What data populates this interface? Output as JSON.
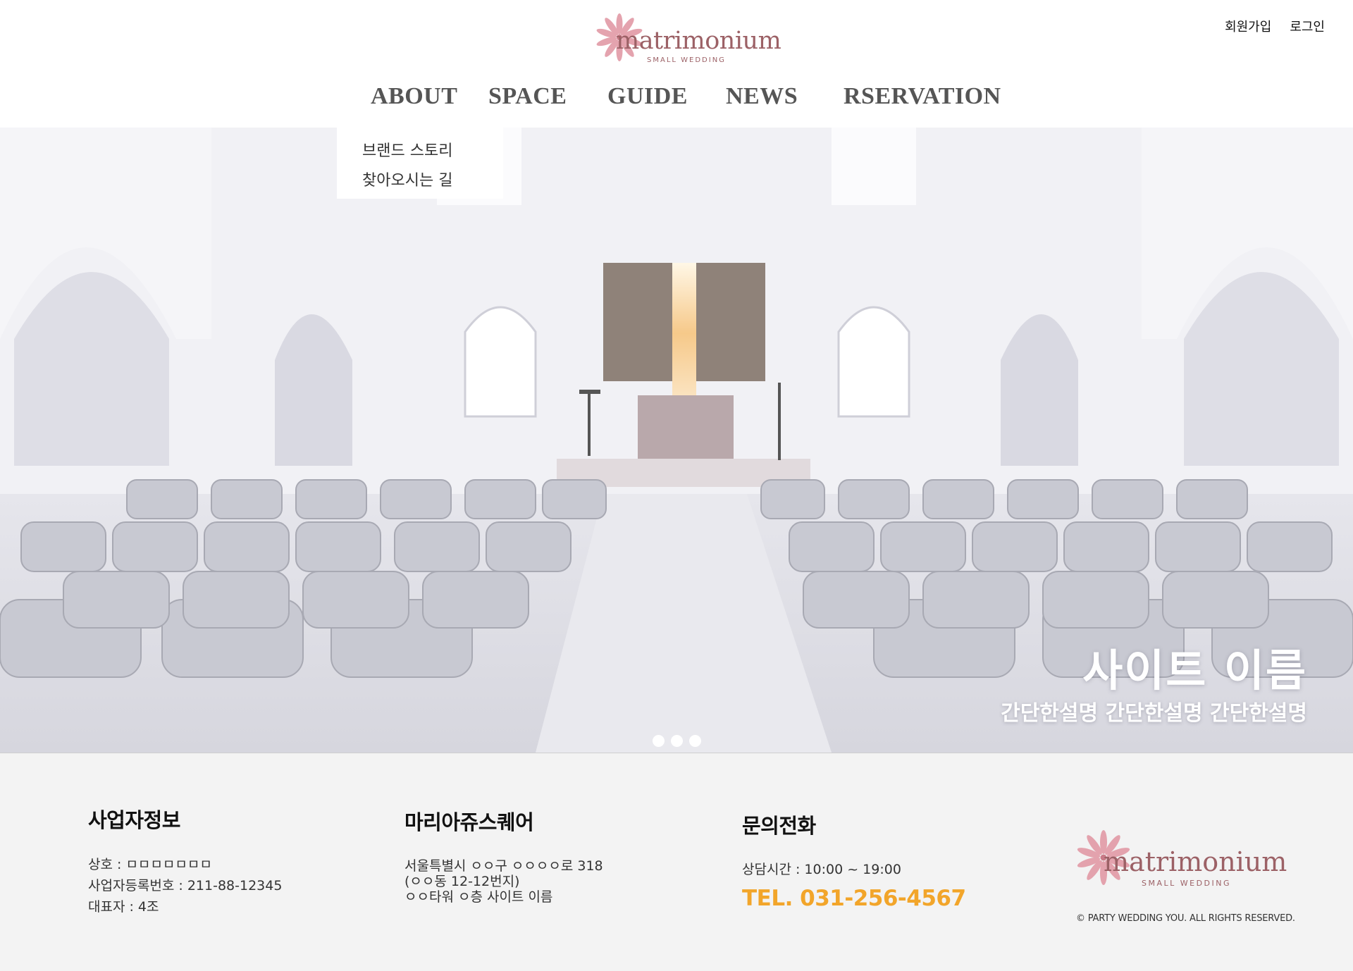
{
  "brand": {
    "name": "matrimonium",
    "tagline": "SMALL WEDDING"
  },
  "account": {
    "signup": "회원가입",
    "login": "로그인"
  },
  "nav": {
    "items": [
      {
        "label": "ABOUT"
      },
      {
        "label": "SPACE"
      },
      {
        "label": "GUIDE"
      },
      {
        "label": "NEWS"
      },
      {
        "label": "RSERVATION"
      }
    ]
  },
  "dropdown": {
    "items": [
      {
        "label": "브랜드 스토리"
      },
      {
        "label": "찾아오시는 길"
      }
    ]
  },
  "hero": {
    "title": "사이트 이름",
    "description": "간단한설명 간단한설명 간단한설명",
    "slide_count": 3
  },
  "footer": {
    "business": {
      "title": "사업자정보",
      "lines": [
        "상호 : ㅁㅁㅁㅁㅁㅁㅁ",
        "사업자등록번호 : 211-88-12345",
        "대표자 : 4조"
      ]
    },
    "venue": {
      "title": "마리아쥬스퀘어",
      "lines": [
        "서울특별시 ㅇㅇ구 ㅇㅇㅇㅇ로 318",
        "(ㅇㅇ동 12-12번지)",
        "ㅇㅇ타워 ㅇ층 사이트 이름"
      ]
    },
    "contact": {
      "title": "문의전화",
      "hours": "상담시간 : 10:00 ~ 19:00",
      "tel": "TEL. 031-256-4567"
    },
    "copyright": "© PARTY WEDDING YOU. ALL RIGHTS RESERVED."
  },
  "colors": {
    "brand": "#9c6166",
    "flower": "#e29aa6",
    "tel": "#f2a52a",
    "footer_bg": "#f3f3f3",
    "nav_text": "#555555"
  }
}
